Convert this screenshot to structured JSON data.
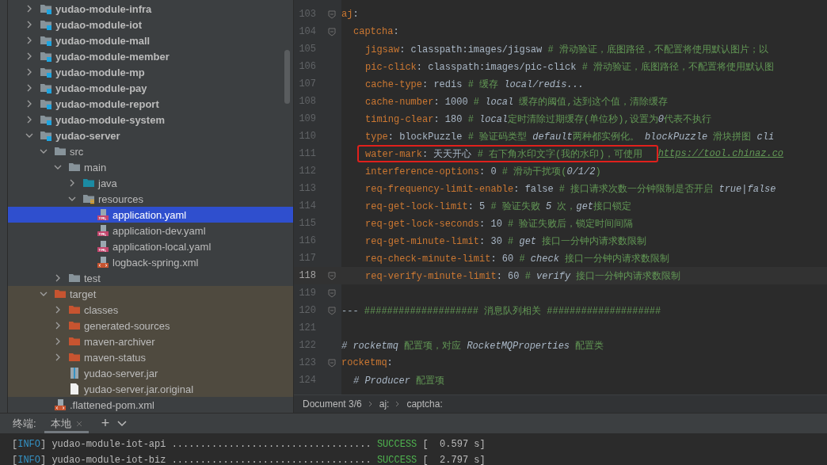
{
  "project_tree": [
    {
      "label": "yudao-module-infra",
      "kind": "module",
      "expanded": false,
      "selected": false
    },
    {
      "label": "yudao-module-iot",
      "kind": "module",
      "expanded": false,
      "selected": false
    },
    {
      "label": "yudao-module-mall",
      "kind": "module",
      "expanded": false,
      "selected": false
    },
    {
      "label": "yudao-module-member",
      "kind": "module",
      "expanded": false,
      "selected": false
    },
    {
      "label": "yudao-module-mp",
      "kind": "module",
      "expanded": false,
      "selected": false
    },
    {
      "label": "yudao-module-pay",
      "kind": "module",
      "expanded": false,
      "selected": false
    },
    {
      "label": "yudao-module-report",
      "kind": "module",
      "expanded": false,
      "selected": false
    },
    {
      "label": "yudao-module-system",
      "kind": "module",
      "expanded": false,
      "selected": false
    },
    {
      "label": "yudao-server",
      "kind": "module",
      "expanded": true,
      "selected": false,
      "children": [
        {
          "label": "src",
          "kind": "folder",
          "expanded": true,
          "selected": false,
          "excluded": false,
          "children": [
            {
              "label": "main",
              "kind": "folder",
              "expanded": true,
              "selected": false,
              "children": [
                {
                  "label": "java",
                  "kind": "source-folder",
                  "expanded": false,
                  "selected": false
                },
                {
                  "label": "resources",
                  "kind": "resource-folder",
                  "expanded": true,
                  "selected": false,
                  "children": [
                    {
                      "label": "application.yaml",
                      "kind": "yaml",
                      "selected": true
                    },
                    {
                      "label": "application-dev.yaml",
                      "kind": "yaml",
                      "selected": false
                    },
                    {
                      "label": "application-local.yaml",
                      "kind": "yaml",
                      "selected": false
                    },
                    {
                      "label": "logback-spring.xml",
                      "kind": "xml",
                      "selected": false
                    }
                  ]
                }
              ]
            },
            {
              "label": "test",
              "kind": "folder",
              "expanded": false,
              "selected": false
            }
          ]
        },
        {
          "label": "target",
          "kind": "excluded-folder",
          "expanded": true,
          "selected": false,
          "excluded": true,
          "children": [
            {
              "label": "classes",
              "kind": "excluded-folder",
              "expanded": false,
              "selected": false
            },
            {
              "label": "generated-sources",
              "kind": "excluded-folder",
              "expanded": false,
              "selected": false
            },
            {
              "label": "maven-archiver",
              "kind": "excluded-folder",
              "expanded": false,
              "selected": false
            },
            {
              "label": "maven-status",
              "kind": "excluded-folder",
              "expanded": false,
              "selected": false
            },
            {
              "label": "yudao-server.jar",
              "kind": "jar",
              "selected": false
            },
            {
              "label": "yudao-server.jar.original",
              "kind": "file",
              "selected": false
            }
          ]
        },
        {
          "label": ".flattened-pom.xml",
          "kind": "xml",
          "selected": false,
          "excluded": false
        }
      ]
    }
  ],
  "editor": {
    "lines": [
      {
        "number": "103",
        "fold": true,
        "current": false,
        "segments": [
          {
            "kind": "key",
            "text": "aj"
          },
          {
            "kind": "punct",
            "text": ":"
          }
        ],
        "children": [
          {
            "number": "104",
            "fold": true,
            "current": false,
            "segments": [
              {
                "kind": "key",
                "text": "captcha"
              },
              {
                "kind": "punct",
                "text": ":"
              }
            ],
            "children": [
              {
                "number": "105",
                "fold": false,
                "current": false,
                "segments": [
                  {
                    "kind": "key",
                    "text": "jigsaw"
                  },
                  {
                    "kind": "punct",
                    "text": ":"
                  },
                  {
                    "kind": "value",
                    "text": " classpath:images/jigsaw "
                  },
                  {
                    "kind": "comment",
                    "text": "# 滑动验证，底图路径，不配置将使用默认图片；以"
                  }
                ]
              },
              {
                "number": "106",
                "fold": false,
                "current": false,
                "segments": [
                  {
                    "kind": "key",
                    "text": "pic-click"
                  },
                  {
                    "kind": "punct",
                    "text": ":"
                  },
                  {
                    "kind": "value",
                    "text": " classpath:images/pic-click "
                  },
                  {
                    "kind": "comment",
                    "text": "# 滑动验证，底图路径，不配置将使用默认图"
                  }
                ]
              },
              {
                "number": "107",
                "fold": false,
                "current": false,
                "segments": [
                  {
                    "kind": "key",
                    "text": "cache-type"
                  },
                  {
                    "kind": "punct",
                    "text": ":"
                  },
                  {
                    "kind": "value",
                    "text": " redis "
                  },
                  {
                    "kind": "comment",
                    "text": "# 缓存 "
                  },
                  {
                    "kind": "comment-italic",
                    "text": "local/redis..."
                  }
                ]
              },
              {
                "number": "108",
                "fold": false,
                "current": false,
                "segments": [
                  {
                    "kind": "key",
                    "text": "cache-number"
                  },
                  {
                    "kind": "punct",
                    "text": ":"
                  },
                  {
                    "kind": "value",
                    "text": " 1000 "
                  },
                  {
                    "kind": "comment",
                    "text": "# "
                  },
                  {
                    "kind": "comment-italic",
                    "text": "local"
                  },
                  {
                    "kind": "comment",
                    "text": " 缓存的阈值,达到这个值，清除缓存"
                  }
                ]
              },
              {
                "number": "109",
                "fold": false,
                "current": false,
                "segments": [
                  {
                    "kind": "key",
                    "text": "timing-clear"
                  },
                  {
                    "kind": "punct",
                    "text": ":"
                  },
                  {
                    "kind": "value",
                    "text": " 180 "
                  },
                  {
                    "kind": "comment",
                    "text": "# "
                  },
                  {
                    "kind": "comment-italic",
                    "text": "local"
                  },
                  {
                    "kind": "comment",
                    "text": "定时清除过期缓存(单位秒),设置为"
                  },
                  {
                    "kind": "comment-italic",
                    "text": "0"
                  },
                  {
                    "kind": "comment",
                    "text": "代表不执行"
                  }
                ]
              },
              {
                "number": "110",
                "fold": false,
                "current": false,
                "segments": [
                  {
                    "kind": "key",
                    "text": "type"
                  },
                  {
                    "kind": "punct",
                    "text": ":"
                  },
                  {
                    "kind": "value",
                    "text": " blockPuzzle "
                  },
                  {
                    "kind": "comment",
                    "text": "# 验证码类型 "
                  },
                  {
                    "kind": "comment-italic",
                    "text": "default"
                  },
                  {
                    "kind": "comment",
                    "text": "两种都实例化。 "
                  },
                  {
                    "kind": "comment-italic",
                    "text": "blockPuzzle"
                  },
                  {
                    "kind": "comment",
                    "text": " 滑块拼图 "
                  },
                  {
                    "kind": "comment-italic",
                    "text": "cli"
                  }
                ]
              },
              {
                "number": "111",
                "fold": false,
                "current": false,
                "annotated": true,
                "segments": [
                  {
                    "kind": "key",
                    "text": "water-mark"
                  },
                  {
                    "kind": "punct",
                    "text": ":"
                  },
                  {
                    "kind": "value",
                    "text": " 天天开心 "
                  },
                  {
                    "kind": "comment",
                    "text": "# 右下角水印文字(我的水印)，可使用 "
                  },
                  {
                    "kind": "link",
                    "text": "https://tool.chinaz.co"
                  }
                ]
              },
              {
                "number": "112",
                "fold": false,
                "current": false,
                "segments": [
                  {
                    "kind": "key",
                    "text": "interference-options"
                  },
                  {
                    "kind": "punct",
                    "text": ":"
                  },
                  {
                    "kind": "value",
                    "text": " 0 "
                  },
                  {
                    "kind": "comment",
                    "text": "# 滑动干扰项("
                  },
                  {
                    "kind": "comment-italic",
                    "text": "0/1/2"
                  },
                  {
                    "kind": "comment",
                    "text": ")"
                  }
                ]
              },
              {
                "number": "113",
                "fold": false,
                "current": false,
                "segments": [
                  {
                    "kind": "key",
                    "text": "req-frequency-limit-enable"
                  },
                  {
                    "kind": "punct",
                    "text": ":"
                  },
                  {
                    "kind": "value",
                    "text": " false "
                  },
                  {
                    "kind": "comment",
                    "text": "# 接口请求次数一分钟限制是否开启 "
                  },
                  {
                    "kind": "comment-italic",
                    "text": "true|false"
                  }
                ]
              },
              {
                "number": "114",
                "fold": false,
                "current": false,
                "segments": [
                  {
                    "kind": "key",
                    "text": "req-get-lock-limit"
                  },
                  {
                    "kind": "punct",
                    "text": ":"
                  },
                  {
                    "kind": "value",
                    "text": " 5 "
                  },
                  {
                    "kind": "comment",
                    "text": "# 验证失败 "
                  },
                  {
                    "kind": "comment-italic",
                    "text": "5"
                  },
                  {
                    "kind": "comment",
                    "text": " 次，"
                  },
                  {
                    "kind": "comment-italic",
                    "text": "get"
                  },
                  {
                    "kind": "comment",
                    "text": "接口锁定"
                  }
                ]
              },
              {
                "number": "115",
                "fold": false,
                "current": false,
                "segments": [
                  {
                    "kind": "key",
                    "text": "req-get-lock-seconds"
                  },
                  {
                    "kind": "punct",
                    "text": ":"
                  },
                  {
                    "kind": "value",
                    "text": " 10 "
                  },
                  {
                    "kind": "comment",
                    "text": "# 验证失败后，锁定时间间隔"
                  }
                ]
              },
              {
                "number": "116",
                "fold": false,
                "current": false,
                "segments": [
                  {
                    "kind": "key",
                    "text": "req-get-minute-limit"
                  },
                  {
                    "kind": "punct",
                    "text": ":"
                  },
                  {
                    "kind": "value",
                    "text": " 30 "
                  },
                  {
                    "kind": "comment",
                    "text": "# "
                  },
                  {
                    "kind": "comment-italic",
                    "text": "get"
                  },
                  {
                    "kind": "comment",
                    "text": " 接口一分钟内请求数限制"
                  }
                ]
              },
              {
                "number": "117",
                "fold": false,
                "current": false,
                "segments": [
                  {
                    "kind": "key",
                    "text": "req-check-minute-limit"
                  },
                  {
                    "kind": "punct",
                    "text": ":"
                  },
                  {
                    "kind": "value",
                    "text": " 60 "
                  },
                  {
                    "kind": "comment",
                    "text": "# "
                  },
                  {
                    "kind": "comment-italic",
                    "text": "check"
                  },
                  {
                    "kind": "comment",
                    "text": " 接口一分钟内请求数限制"
                  }
                ]
              },
              {
                "number": "118",
                "fold": true,
                "current": true,
                "segments": [
                  {
                    "kind": "key",
                    "text": "req-verify-minute-limit"
                  },
                  {
                    "kind": "punct",
                    "text": ":"
                  },
                  {
                    "kind": "value",
                    "text": " 60 "
                  },
                  {
                    "kind": "comment",
                    "text": "# "
                  },
                  {
                    "kind": "comment-italic",
                    "text": "verify"
                  },
                  {
                    "kind": "comment",
                    "text": " 接口一分钟内请求数限制"
                  }
                ]
              }
            ]
          }
        ]
      },
      {
        "number": "119",
        "fold": true,
        "current": false
      },
      {
        "number": "120",
        "fold": true,
        "current": false,
        "segments": [
          {
            "kind": "punct",
            "text": "--- "
          },
          {
            "kind": "comment",
            "text": "#################### 消息队列相关 ####################"
          }
        ]
      },
      {
        "number": "121",
        "fold": false,
        "current": false
      },
      {
        "number": "122",
        "fold": false,
        "current": false,
        "segments": [
          {
            "kind": "comment-italic",
            "text": "# rocketmq"
          },
          {
            "kind": "comment",
            "text": " 配置项，对应 "
          },
          {
            "kind": "comment-italic",
            "text": "RocketMQProperties"
          },
          {
            "kind": "comment",
            "text": " 配置类"
          }
        ]
      },
      {
        "number": "123",
        "fold": true,
        "current": false,
        "segments": [
          {
            "kind": "key",
            "text": "rocketmq"
          },
          {
            "kind": "punct",
            "text": ":"
          }
        ],
        "children": [
          {
            "number": "124",
            "fold": false,
            "current": false,
            "segments": [
              {
                "kind": "comment-italic",
                "text": "# Producer"
              },
              {
                "kind": "comment",
                "text": " 配置项"
              }
            ]
          }
        ]
      }
    ],
    "breadcrumbs": [
      "Document 3/6",
      "aj:",
      "captcha:"
    ]
  },
  "terminal": {
    "title": "终端:",
    "tabs": [
      {
        "label": "本地",
        "selected": true
      }
    ],
    "add": "+",
    "lines": [
      [
        {
          "kind": "bracket",
          "text": "["
        },
        {
          "kind": "info",
          "text": "INFO"
        },
        {
          "kind": "text",
          "text": "] yudao-module-iot-api ................................... "
        },
        {
          "kind": "success",
          "text": "SUCCESS"
        },
        {
          "kind": "text",
          "text": " [  0.597 s]"
        }
      ],
      [
        {
          "kind": "bracket",
          "text": "["
        },
        {
          "kind": "info",
          "text": "INFO"
        },
        {
          "kind": "text",
          "text": "] yudao-module-iot-biz ................................... "
        },
        {
          "kind": "success",
          "text": "SUCCESS"
        },
        {
          "kind": "text",
          "text": " [  2.797 s]"
        }
      ]
    ]
  }
}
